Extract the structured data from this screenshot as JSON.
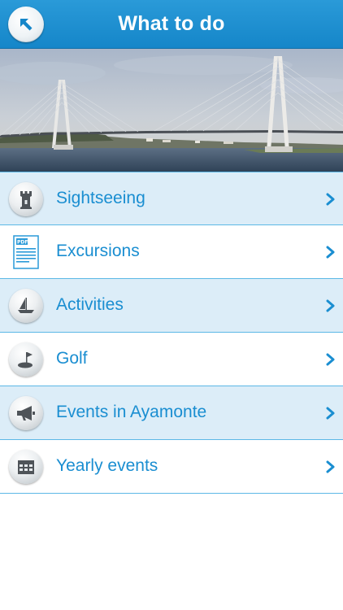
{
  "header": {
    "title": "What to do",
    "back_icon": "arrow-up-left-icon"
  },
  "banner": {
    "description_icon": "bridge-photo"
  },
  "menu": {
    "items": [
      {
        "label": "Sightseeing",
        "icon": "castle-tower-icon"
      },
      {
        "label": "Excursions",
        "icon": "pdf-document-icon",
        "icon_text": "PDF"
      },
      {
        "label": "Activities",
        "icon": "sailboat-icon"
      },
      {
        "label": "Golf",
        "icon": "golf-flag-icon"
      },
      {
        "label": "Events in Ayamonte",
        "icon": "megaphone-icon"
      },
      {
        "label": "Yearly events",
        "icon": "calendar-icon"
      }
    ]
  },
  "colors": {
    "header": "#1e90d0",
    "accent_text": "#1a8ed1",
    "row_shaded": "#dcedf8",
    "divider": "#5cb8e6"
  }
}
